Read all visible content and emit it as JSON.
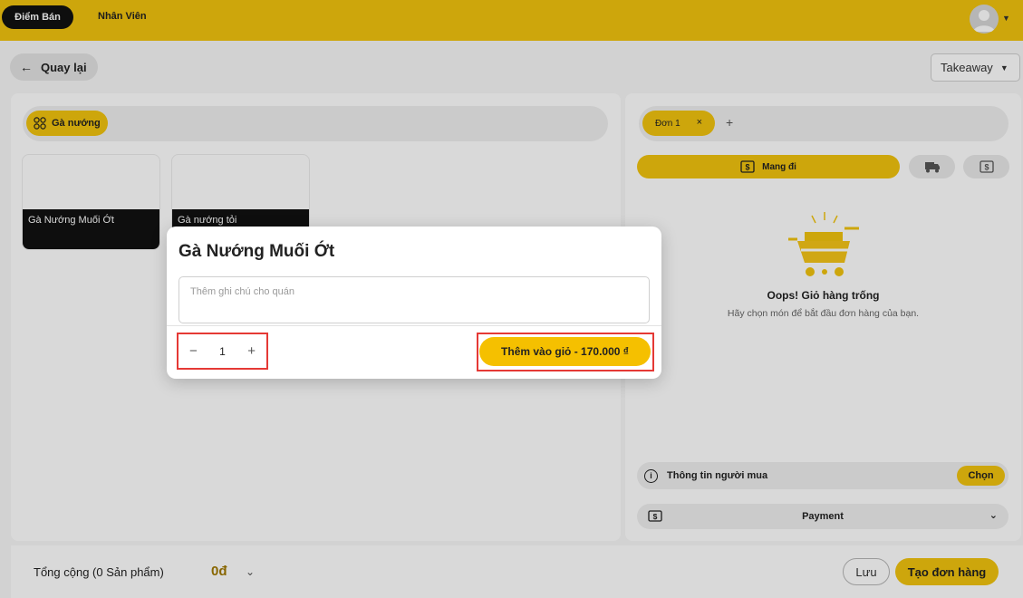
{
  "topbar": {
    "nav_active": "Điểm Bán",
    "nav_staff": "Nhân Viên"
  },
  "toolbar": {
    "back_label": "Quay lại",
    "order_type": "Takeaway"
  },
  "categories": [
    {
      "label": "Gà nướng",
      "active": true
    }
  ],
  "products": [
    {
      "name": "Gà Nướng Muối Ớt"
    },
    {
      "name": "Gà nướng tỏi"
    }
  ],
  "orders": {
    "tabs": [
      {
        "label": "Đơn 1",
        "close": "×"
      }
    ],
    "add": "+",
    "modes": {
      "main_label": "Mang đi"
    }
  },
  "cart": {
    "empty_title": "Oops! Giỏ hàng trống",
    "empty_subtitle": "Hãy chọn món để bắt đầu đơn hàng của bạn."
  },
  "buyer": {
    "label": "Thông tin người mua",
    "choose": "Chọn"
  },
  "payment": {
    "label": "Payment"
  },
  "footer": {
    "total_label": "Tổng cộng (0 Sản phẩm)",
    "total_value": "0đ",
    "save": "Lưu",
    "create": "Tạo đơn hàng"
  },
  "modal": {
    "title": "Gà Nướng Muối Ớt",
    "note_placeholder": "Thêm ghi chú cho quán",
    "quantity": "1",
    "minus": "−",
    "plus": "+",
    "add_to_cart": "Thêm vào giỏ - 170.000 ₫"
  },
  "colors": {
    "accent": "#f1c40f",
    "highlight_outline": "#e53935",
    "price": "#a07800"
  }
}
